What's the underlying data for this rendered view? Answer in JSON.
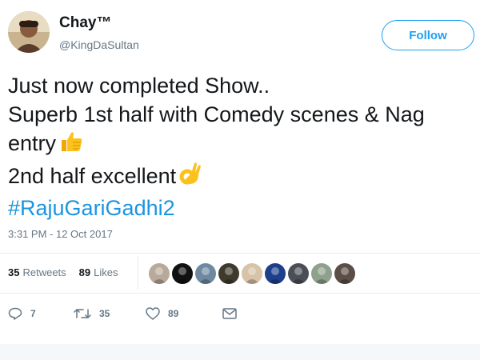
{
  "author": {
    "display_name": "Chay™",
    "screen_name": "@KingDaSultan",
    "avatar_icon": "user-avatar"
  },
  "follow_label": "Follow",
  "tweet": {
    "line1": "Just now completed Show..",
    "line2": "Superb 1st half with Comedy scenes & Nag",
    "line3": "entry",
    "line4": "2nd half  excellent",
    "hashtag": "#RajuGariGadhi2",
    "emoji1": "thumbs-up-emoji",
    "emoji2": "ok-hand-emoji"
  },
  "timestamp": "3:31 PM - 12 Oct 2017",
  "stats": {
    "retweets_count": "35",
    "retweets_label": "Retweets",
    "likes_count": "89",
    "likes_label": "Likes"
  },
  "likers": [
    {
      "color": "#b9a99a"
    },
    {
      "color": "#111111"
    },
    {
      "color": "#6f8aa0"
    },
    {
      "color": "#3f3a2e"
    },
    {
      "color": "#d8c2a8"
    },
    {
      "color": "#1d3f8c"
    },
    {
      "color": "#4a4f57"
    },
    {
      "color": "#8fa08d"
    },
    {
      "color": "#5b4e46"
    }
  ],
  "actions": {
    "reply_count": "7",
    "retweet_count": "35",
    "like_count": "89"
  },
  "colors": {
    "accent": "#1da1f2",
    "hashtag": "#1b95e0",
    "muted": "#657786",
    "emoji": "#fcc21b"
  }
}
